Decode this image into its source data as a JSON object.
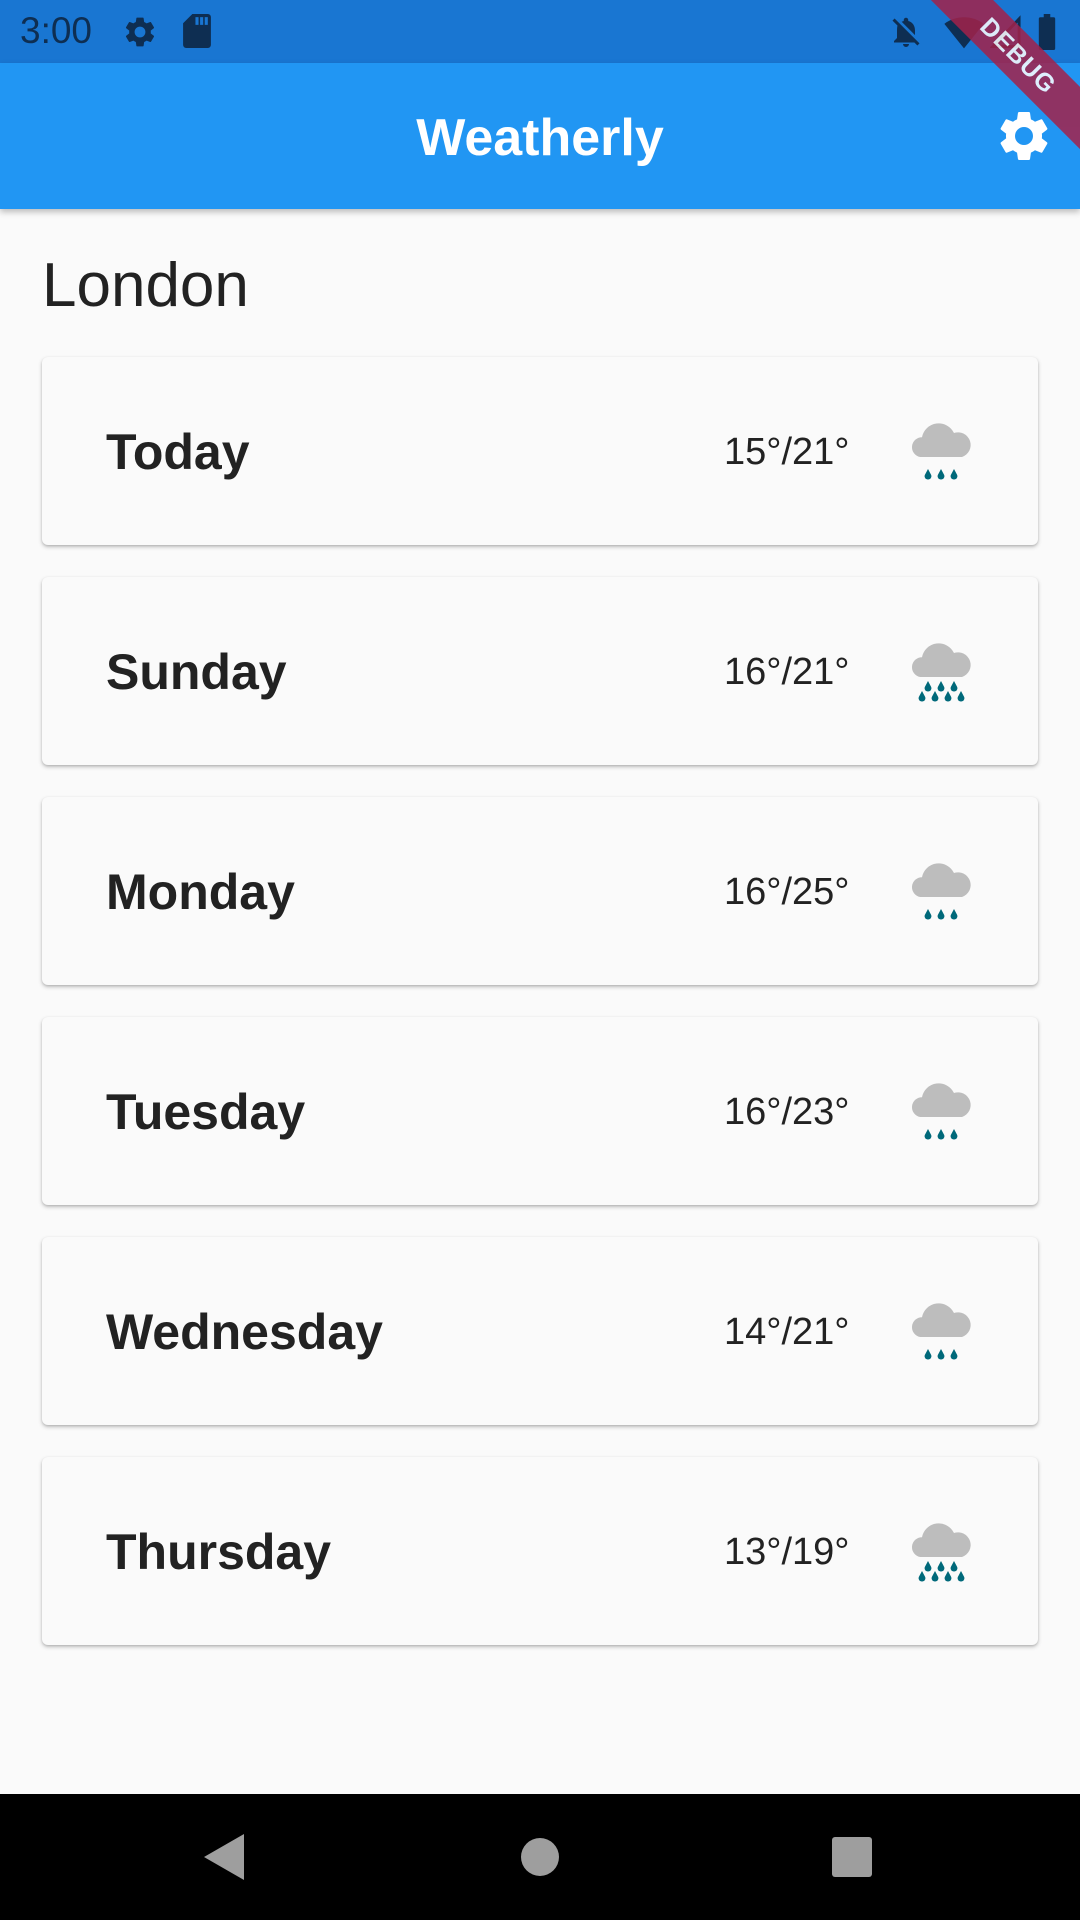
{
  "status_bar": {
    "time": "3:00",
    "icons": [
      "gear-icon",
      "sd-card-icon",
      "notifications-off-icon",
      "wifi-icon",
      "signal-icon",
      "battery-icon"
    ]
  },
  "app_bar": {
    "title": "Weatherly",
    "settings_icon": "gear-icon",
    "background": "#2196f3"
  },
  "debug_banner": "DEBUG",
  "city": "London",
  "forecast": [
    {
      "day": "Today",
      "temp": "15°/21°",
      "icon": "light-rain-icon"
    },
    {
      "day": "Sunday",
      "temp": "16°/21°",
      "icon": "heavy-rain-icon"
    },
    {
      "day": "Monday",
      "temp": "16°/25°",
      "icon": "light-rain-icon"
    },
    {
      "day": "Tuesday",
      "temp": "16°/23°",
      "icon": "light-rain-icon"
    },
    {
      "day": "Wednesday",
      "temp": "14°/21°",
      "icon": "light-rain-icon"
    },
    {
      "day": "Thursday",
      "temp": "13°/19°",
      "icon": "heavy-rain-icon"
    }
  ],
  "colors": {
    "status_bar": "#1976d2",
    "accent": "#2196f3",
    "cloud": "#bdbdbd",
    "rain": "#00697a"
  },
  "nav_bar": [
    "back-icon",
    "home-icon",
    "recents-icon"
  ]
}
